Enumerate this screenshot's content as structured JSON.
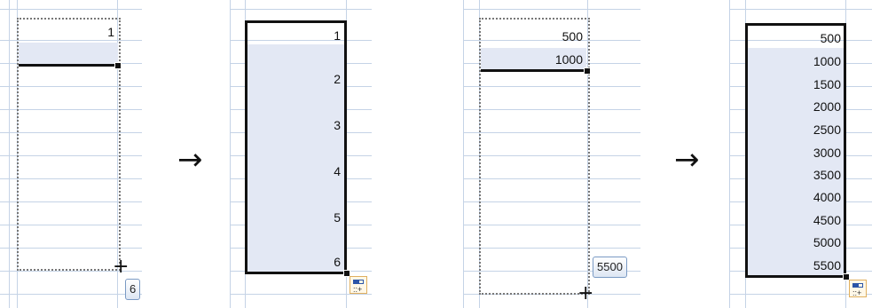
{
  "step1": {
    "values": [
      "1"
    ],
    "tooltip": "6"
  },
  "step2": {
    "values": [
      "1",
      "2",
      "3",
      "4",
      "5",
      "6"
    ]
  },
  "step3": {
    "values": [
      "500",
      "1000"
    ],
    "tooltip": "5500"
  },
  "step4": {
    "values": [
      "500",
      "1000",
      "1500",
      "2000",
      "2500",
      "3000",
      "3500",
      "4000",
      "4500",
      "5000",
      "5500"
    ]
  },
  "arrows": [
    "→",
    "→"
  ],
  "cursor_glyph": "+",
  "autofill_options_icon": "autofill-options-icon"
}
